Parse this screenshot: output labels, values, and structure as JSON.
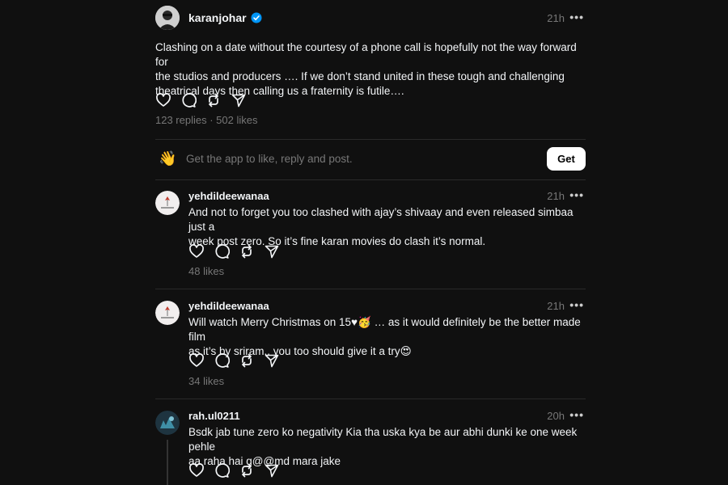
{
  "post": {
    "username": "karanjohar",
    "verified": true,
    "time": "21h",
    "more": "•••",
    "lines": [
      "Clashing on a date without the courtesy of a phone call is hopefully not the way forward for",
      "the studios and producers …. If we don’t stand united in these tough and challenging",
      "theatrical days then calling us a fraternity is futile…."
    ],
    "stats": "123 replies · 502 likes"
  },
  "banner": {
    "emoji": "👋",
    "text": "Get the app to like, reply and post.",
    "button": "Get"
  },
  "replies": [
    {
      "username": "yehdildeewanaa",
      "time": "21h",
      "lines": [
        "And not to forget you too clashed with ajay’s shivaay and even released simbaa just a",
        "week post zero. So it’s fine karan movies do clash it’s normal."
      ],
      "likes": "48 likes"
    },
    {
      "username": "yehdildeewanaa",
      "time": "21h",
      "lines": [
        "Will watch Merry Christmas on 15♥🥳 … as it would definitely be the better made film",
        "as it’s by sriram.. you too should give it a try😍"
      ],
      "likes": "34 likes"
    },
    {
      "username": "rah.ul0211",
      "time": "20h",
      "lines": [
        "Bsdk jab tune zero ko negativity Kia tha uska kya be aur abhi dunki ke one week pehle",
        "aa raha hai g@@md mara jake"
      ],
      "likes": ""
    }
  ],
  "icons": [
    "heart-icon",
    "comment-icon",
    "repost-icon",
    "share-icon",
    "verified-badge-icon",
    "more-icon"
  ]
}
